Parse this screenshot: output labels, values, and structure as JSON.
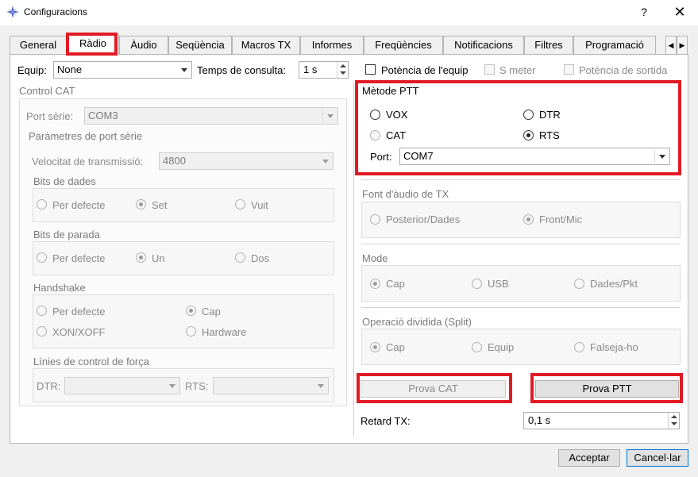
{
  "window": {
    "title": "Configuracions",
    "help": "?",
    "close": "✕"
  },
  "tabs": [
    "General",
    "Ràdio",
    "Àudio",
    "Seqüència",
    "Macros TX",
    "Informes",
    "Freqüències",
    "Notificacions",
    "Filtres",
    "Programació"
  ],
  "tab_scroll": {
    "left": "◀",
    "right": "▶"
  },
  "top": {
    "equip_label": "Equip:",
    "equip_value": "None",
    "poll_label": "Temps de consulta:",
    "poll_value": "1 s",
    "power_equip": "Potència de l'equip",
    "smeter": "S meter",
    "power_out": "Potència de sortida"
  },
  "cat": {
    "title": "Control CAT",
    "port_label": "Port sèrie:",
    "port_value": "COM3",
    "params_title": "Paràmetres de port sèrie",
    "baud_label": "Velocitat de transmissió:",
    "baud_value": "4800",
    "databits_title": "Bits de dades",
    "databits": {
      "default": "Per defecte",
      "seven": "Set",
      "eight": "Vuit"
    },
    "stopbits_title": "Bits de parada",
    "stopbits": {
      "default": "Per defecte",
      "one": "Un",
      "two": "Dos"
    },
    "handshake_title": "Handshake",
    "handshake": {
      "default": "Per defecte",
      "none": "Cap",
      "xon": "XON/XOFF",
      "hardware": "Hardware"
    },
    "control_title": "Línies de control de força",
    "dtr_label": "DTR:",
    "rts_label": "RTS:"
  },
  "ptt": {
    "title": "Mètode PTT",
    "vox": "VOX",
    "dtr": "DTR",
    "cat": "CAT",
    "rts": "RTS",
    "port_label": "Port:",
    "port_value": "COM7"
  },
  "audio_src": {
    "title": "Font d'àudio de TX",
    "rear": "Posterior/Dades",
    "front": "Front/Mic"
  },
  "mode": {
    "title": "Mode",
    "none": "Cap",
    "usb": "USB",
    "data": "Dades/Pkt"
  },
  "split": {
    "title": "Operació dividida (Split)",
    "none": "Cap",
    "rig": "Equip",
    "fake": "Falseja-ho"
  },
  "tests": {
    "cat": "Prova CAT",
    "ptt": "Prova PTT"
  },
  "tx_delay": {
    "label": "Retard TX:",
    "value": "0,1 s"
  },
  "footer": {
    "ok": "Acceptar",
    "cancel": "Cancel·lar"
  },
  "colors": {
    "highlight": "#e01b24",
    "focus": "#0078d7"
  }
}
